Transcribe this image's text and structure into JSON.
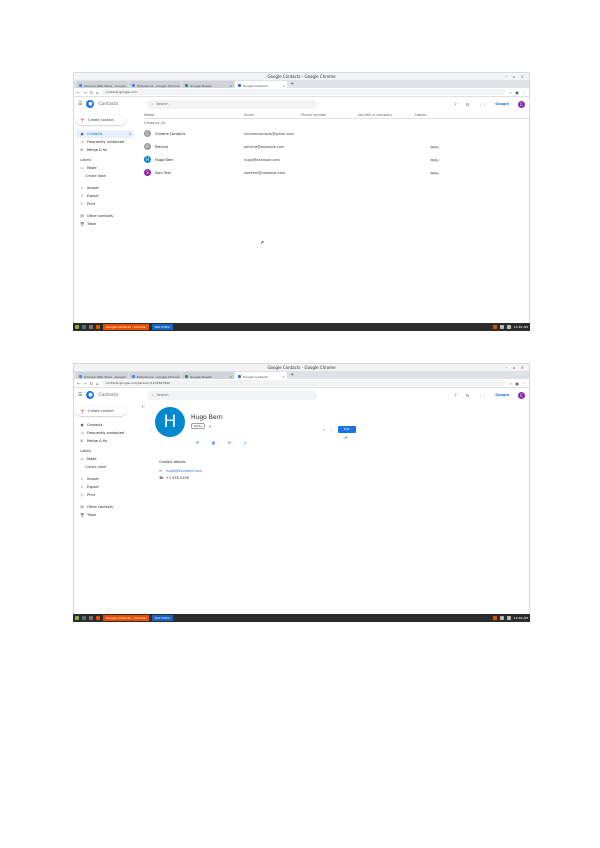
{
  "window_title": "Google Contacts - Google Chrome",
  "window_controls": "– ▫ ×",
  "tabs": [
    {
      "label": "Chrome Web Store - Google"
    },
    {
      "label": "Extensions - Google Chrome"
    },
    {
      "label": "Google Sheets"
    },
    {
      "label": "Google Contacts"
    }
  ],
  "shot1": {
    "url": "contacts.google.com",
    "search_placeholder": "Search",
    "app_name": "Contacts",
    "account_initial": "C",
    "create_label": "Create contact",
    "nav": [
      {
        "label": "Contacts",
        "count": "4"
      },
      {
        "label": "Frequently contacted",
        "count": ""
      },
      {
        "label": "Merge & fix",
        "count": ""
      }
    ],
    "labels_header": "Labels",
    "label_items": [
      {
        "label": "Mode",
        "count": ""
      },
      {
        "label": "Create label",
        "count": ""
      }
    ],
    "other_items": [
      {
        "label": "Import"
      },
      {
        "label": "Export"
      },
      {
        "label": "Print"
      }
    ],
    "other_items2": [
      {
        "label": "Other contacts"
      },
      {
        "label": "Trash"
      }
    ],
    "columns": [
      "Name",
      "Email",
      "Phone number",
      "Job title & company",
      "Labels"
    ],
    "subcount": "Contacts (4)",
    "rows": [
      {
        "initial": "C",
        "name": "Chrome Contacts",
        "email": "chromecontacts@gmail.com",
        "label": "",
        "color": "#9e9e9e"
      },
      {
        "initial": "P",
        "name": "Patricia",
        "email": "patricia@example.com",
        "label": "Mode",
        "color": "#9e9e9e"
      },
      {
        "initial": "H",
        "name": "Hugo Bern",
        "email": "hugo@example.com",
        "label": "Mode",
        "color": "#0288d1"
      },
      {
        "initial": "S",
        "name": "Sam Teal",
        "email": "samteal@example.com",
        "label": "Mode",
        "color": "#8e24aa"
      }
    ]
  },
  "shot2": {
    "url": "contacts.google.com/person/c1234567890",
    "search_placeholder": "Search",
    "app_name": "Contacts",
    "account_initial": "C",
    "create_label": "Create contact",
    "nav": [
      {
        "label": "Contacts",
        "count": ""
      },
      {
        "label": "Frequently contacted",
        "count": ""
      },
      {
        "label": "Merge & fix",
        "count": ""
      }
    ],
    "labels_header": "Labels",
    "label_items": [
      {
        "label": "Mode",
        "count": ""
      },
      {
        "label": "Create label",
        "count": ""
      }
    ],
    "other_items": [
      {
        "label": "Import"
      },
      {
        "label": "Export"
      },
      {
        "label": "Print"
      }
    ],
    "other_items2": [
      {
        "label": "Other contacts"
      },
      {
        "label": "Trash"
      }
    ],
    "avatar_initial": "H",
    "contact_name": "Hugo Bern",
    "contact_label": "Mode",
    "edit_label": "Edit",
    "details_header": "Contact details",
    "email": "hugo@example.com",
    "phone": "+1 555 0100"
  },
  "taskbar": {
    "task1": "Google Contacts - Chrome",
    "task2": "Text Editor",
    "clock": "10:49 AM"
  }
}
